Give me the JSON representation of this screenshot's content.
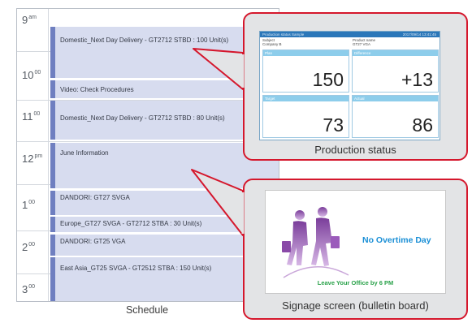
{
  "schedule": {
    "caption": "Schedule",
    "times": [
      {
        "hour": "9",
        "suffix": "am"
      },
      {
        "hour": "10",
        "suffix": "00"
      },
      {
        "hour": "11",
        "suffix": "00"
      },
      {
        "hour": "12",
        "suffix": "pm"
      },
      {
        "hour": "1",
        "suffix": "00"
      },
      {
        "hour": "2",
        "suffix": "00"
      },
      {
        "hour": "3",
        "suffix": "00"
      }
    ],
    "events": [
      "Domestic_Next Day Delivery - GT2712 STBD : 100 Unit(s)",
      "Video: Check Procedures",
      "Domestic_Next Day Delivery - GT2712 STBD : 80 Unit(s)",
      "June Information",
      "DANDORI: GT27 SVGA",
      "Europe_GT27 SVGA - GT2712 STBA : 30 Unit(s)",
      "DANDORI: GT25 VGA",
      "East Asia_GT25 SVGA - GT2512 STBA : 150 Unit(s)"
    ]
  },
  "production": {
    "caption": "Production status",
    "title": "Production status Sample",
    "datetime": "2017/09/14 13:41:45",
    "subject_label": "Subject",
    "subject_value": "Company B",
    "product_label": "Product name",
    "product_value": "GT27 VGA",
    "cells": [
      {
        "label": "Plan",
        "value": "150"
      },
      {
        "label": "Difference",
        "value": "+13"
      },
      {
        "label": "Target",
        "value": "73"
      },
      {
        "label": "Actual",
        "value": "86"
      }
    ]
  },
  "signage": {
    "caption": "Signage screen (bulletin board)",
    "headline": "No Overtime Day",
    "subline": "Leave Your Office by 6 PM"
  },
  "colors": {
    "event_fill": "#d7dcef",
    "event_bar": "#6f7fc0",
    "callout_red": "#d5172c",
    "panel_fill": "#e3e4e6",
    "prod_bar": "#2b77b9",
    "prod_header": "#8dcdeb",
    "sign_blue": "#1a8fd6",
    "sign_green": "#2aa24a"
  }
}
